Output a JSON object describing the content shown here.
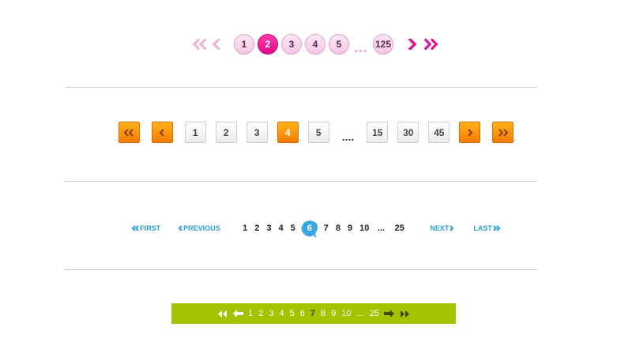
{
  "pager_pink": {
    "pages": [
      "1",
      "2",
      "3",
      "4",
      "5"
    ],
    "active": "2",
    "ellipsis": "...",
    "last": "125",
    "colors": {
      "active": "#e10a8a",
      "inactive_arrow": "#f2b6dc",
      "active_arrow": "#d9159a"
    }
  },
  "pager_orange": {
    "pages": [
      "1",
      "2",
      "3",
      "4",
      "5"
    ],
    "active": "4",
    "ellipsis": "....",
    "extra_pages": [
      "15",
      "30",
      "45"
    ],
    "colors": {
      "accent": "#f57b00"
    }
  },
  "pager_blue": {
    "first_label": "FIRST",
    "previous_label": "PREVIOUS",
    "pages": [
      "1",
      "2",
      "3",
      "4",
      "5",
      "6",
      "7",
      "8",
      "9",
      "10"
    ],
    "active": "6",
    "ellipsis": "...",
    "last_page": "25",
    "next_label": "NEXT",
    "last_label": "LAST",
    "colors": {
      "link": "#2a9fd6",
      "active_blot": "#39a7e0"
    }
  },
  "pager_green": {
    "pages": [
      "1",
      "2",
      "3",
      "4",
      "5",
      "6",
      "7",
      "8",
      "9",
      "10"
    ],
    "active": "7",
    "ellipsis": "...",
    "last_page": "25",
    "colors": {
      "bar": "#a3c200",
      "active_text": "#3f4a00"
    }
  }
}
